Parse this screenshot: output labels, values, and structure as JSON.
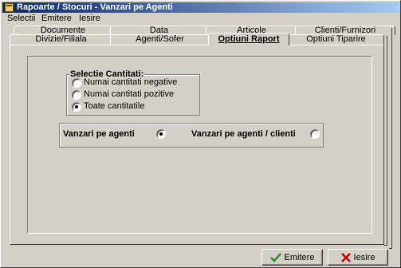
{
  "window": {
    "title": "Rapoarte / Stocuri  - Vanzari pe Agenti"
  },
  "menu": {
    "items": [
      "Selectii",
      "Emitere",
      "Iesire"
    ]
  },
  "tabs": {
    "back_row": [
      "Documente",
      "Data",
      "Articole",
      "Clienti/Furnizori"
    ],
    "front_row": [
      "Divizie/Filiala",
      "Agenti/Sofer",
      "Optiuni Raport",
      "Optiuni Tiparire"
    ],
    "active": "Optiuni Raport"
  },
  "selectie": {
    "title": "Selectie Cantitati:",
    "options": [
      "Numai cantitati negative",
      "Numai cantitati pozitive",
      "Toate cantitatile"
    ],
    "selected_index": 2
  },
  "vanzari": {
    "option_agenti": "Vanzari pe agenti",
    "option_agenti_clienti": "Vanzari pe agenti / clienti",
    "selected": "agenti"
  },
  "buttons": {
    "emitere": "Emitere",
    "iesire": "Iesire"
  },
  "colors": {
    "accent_ok": "#2e8b2e",
    "accent_cancel": "#c00000",
    "title_start": "#0a246a",
    "title_end": "#a6caf0"
  }
}
